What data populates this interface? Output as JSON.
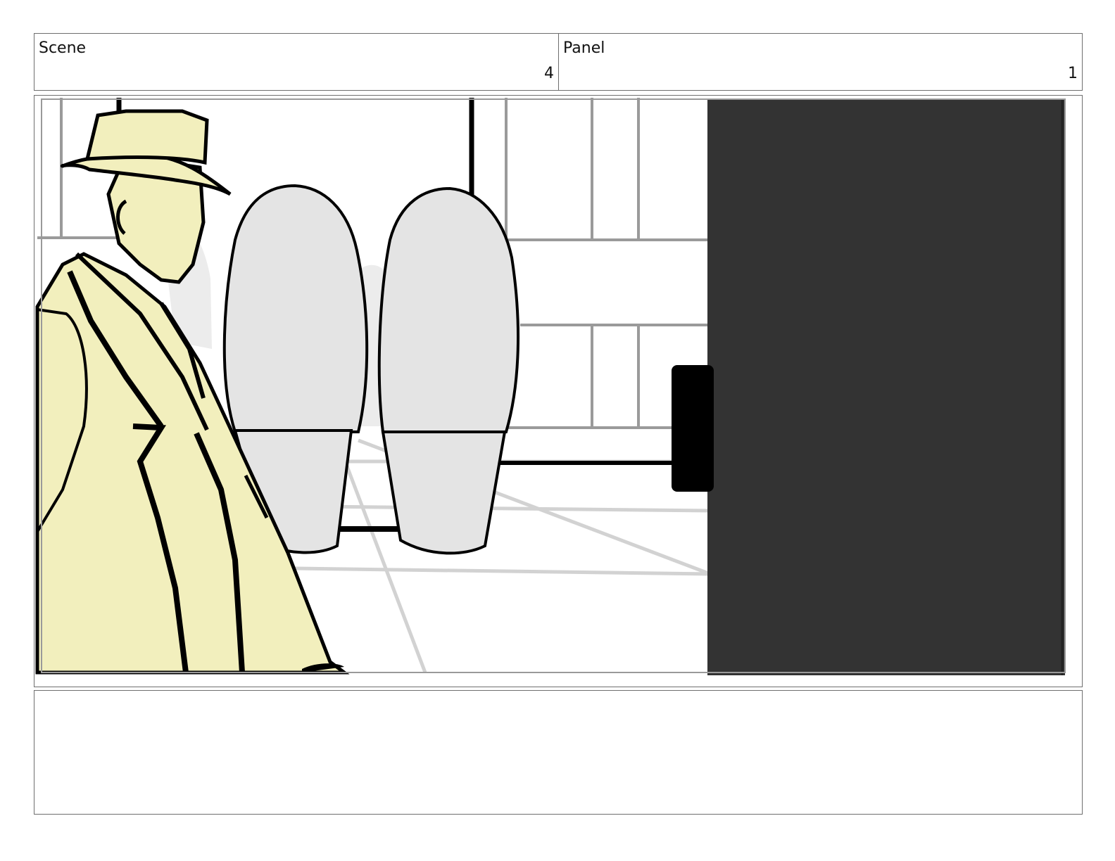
{
  "header": {
    "scene_label": "Scene",
    "scene_value": "4",
    "panel_label": "Panel",
    "panel_value": "1"
  },
  "notes": {
    "text": ""
  },
  "colors": {
    "coat": "#f2efbd",
    "plant": "#e4e4e4",
    "door": "#333333",
    "line": "#000000",
    "window_frame": "#9a9a9a",
    "floor_line": "#d2d2d2"
  },
  "illustration": {
    "subject_icons": [
      "man-in-coat-and-hat-figure",
      "potted-shrub-icon",
      "potted-shrub-icon",
      "dark-door-panel",
      "door-handle-icon"
    ]
  }
}
